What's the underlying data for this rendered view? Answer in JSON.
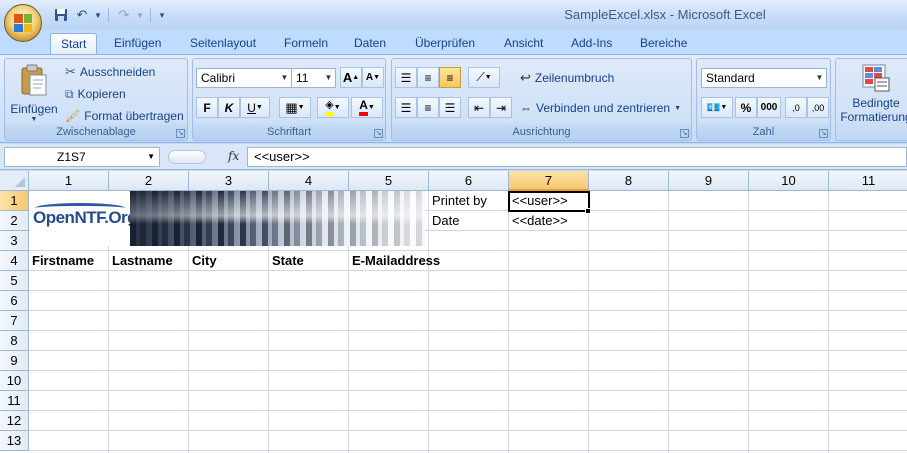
{
  "window": {
    "title": "SampleExcel.xlsx - Microsoft Excel"
  },
  "tabs": [
    "Start",
    "Einfügen",
    "Seitenlayout",
    "Formeln",
    "Daten",
    "Überprüfen",
    "Ansicht",
    "Add-Ins",
    "Bereiche"
  ],
  "ribbon": {
    "clipboard": {
      "label": "Zwischenablage",
      "paste": "Einfügen",
      "cut": "Ausschneiden",
      "copy": "Kopieren",
      "format_painter": "Format übertragen"
    },
    "font": {
      "label": "Schriftart",
      "font_name": "Calibri",
      "font_size": "11",
      "grow": "A",
      "shrink": "A",
      "bold": "F",
      "italic": "K",
      "underline": "U",
      "font_color": "A"
    },
    "alignment": {
      "label": "Ausrichtung",
      "wrap": "Zeilenumbruch",
      "merge": "Verbinden und zentrieren"
    },
    "number": {
      "label": "Zahl",
      "format": "Standard",
      "percent": "%",
      "thousands": "000",
      "inc_decimal": ",0",
      "dec_decimal": ",00"
    },
    "styles": {
      "conditional_line1": "Bedingte",
      "conditional_line2": "Formatierung"
    }
  },
  "formula_bar": {
    "name_box": "Z1S7",
    "fx": "fx",
    "value": "<<user>>"
  },
  "columns": [
    "1",
    "2",
    "3",
    "4",
    "5",
    "6",
    "7",
    "8",
    "9",
    "10",
    "11"
  ],
  "rows": [
    "1",
    "2",
    "3",
    "4",
    "5",
    "6",
    "7",
    "8",
    "9",
    "10",
    "11",
    "12",
    "13"
  ],
  "logo": {
    "text": "OpenNTF.Org"
  },
  "cells": {
    "printed_by_label": "Printet by",
    "printed_by_value": "<<user>>",
    "date_label": "Date",
    "date_value": "<<date>>",
    "headers": [
      "Firstname",
      "Lastname",
      "City",
      "State",
      "E-Mailaddress"
    ]
  },
  "colors": {
    "accent": "#15428b",
    "selected_header": "#f8c871",
    "grid": "#d0d7e5"
  },
  "selection": {
    "column": "7",
    "row": "1"
  }
}
